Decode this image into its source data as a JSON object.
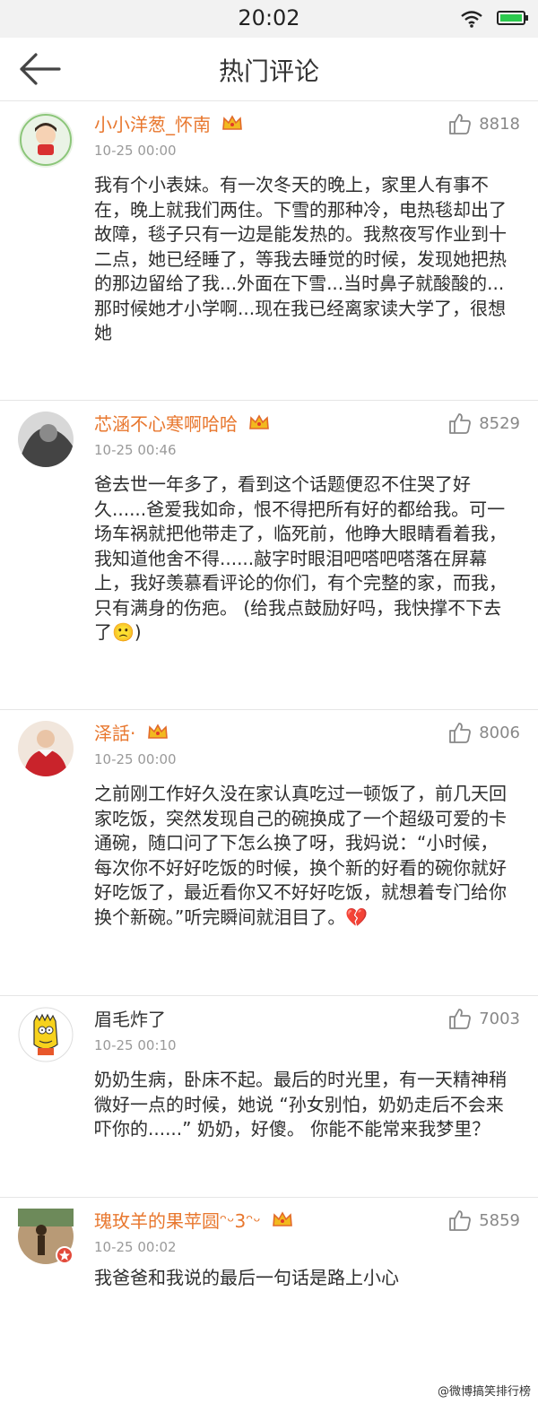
{
  "status_bar": {
    "time": "20:02"
  },
  "header": {
    "title": "热门评论"
  },
  "comments": [
    {
      "username": "小小洋葱_怀南",
      "time": "10-25 00:00",
      "likes": "8818",
      "text": "我有个小表妹。有一次冬天的晚上，家里人有事不在，晚上就我们两住。下雪的那种冷，电热毯却出了故障，毯子只有一边是能发热的。我熬夜写作业到十二点，她已经睡了，等我去睡觉的时候，发现她把热的那边留给了我...外面在下雪...当时鼻子就酸酸的...那时候她才小学啊...现在我已经离家读大学了，很想她"
    },
    {
      "username": "芯涵不心寒啊哈哈",
      "time": "10-25 00:46",
      "likes": "8529",
      "text": "爸去世一年多了，看到这个话题便忍不住哭了好久......爸爱我如命，恨不得把所有好的都给我。可一场车祸就把他带走了，临死前，他睁大眼睛看着我，我知道他舍不得......敲字时眼泪吧嗒吧嗒落在屏幕上，我好羡慕看评论的你们，有个完整的家，而我，只有满身的伤疤。 (给我点鼓励好吗，我快撑不下去了🙁)"
    },
    {
      "username": "泽話·",
      "time": "10-25 00:00",
      "likes": "8006",
      "text": "之前刚工作好久没在家认真吃过一顿饭了，前几天回家吃饭，突然发现自己的碗换成了一个超级可爱的卡通碗，随口问了下怎么换了呀，我妈说：“小时候，每次你不好好吃饭的时候，换个新的好看的碗你就好好吃饭了，最近看你又不好好吃饭，就想着专门给你换个新碗。”听完瞬间就泪目了。💔"
    },
    {
      "username": "眉毛炸了",
      "time": "10-25 00:10",
      "likes": "7003",
      "text": "奶奶生病，卧床不起。最后的时光里，有一天精神稍微好一点的时候，她说 “孙女别怕，奶奶走后不会来吓你的......” 奶奶，好傻。 你能不能常来我梦里？"
    },
    {
      "username": "瑰玫羊的果苹圆ᵔᵕ3ᵔᵕ",
      "time": "10-25 00:02",
      "likes": "5859",
      "text": "我爸爸和我说的最后一句话是路上小心"
    }
  ],
  "watermark": "@微博搞笑排行榜",
  "colors": {
    "username": "#e8772e",
    "meta": "#9a9a9a",
    "text": "#2e2e2e",
    "status_bg": "#f2f2f2",
    "battery": "#2cc94e"
  },
  "icons": {
    "back": "back-arrow-icon",
    "like": "thumbs-up-icon",
    "crown": "vip-crown-icon",
    "wifi": "wifi-icon",
    "battery": "battery-icon"
  }
}
